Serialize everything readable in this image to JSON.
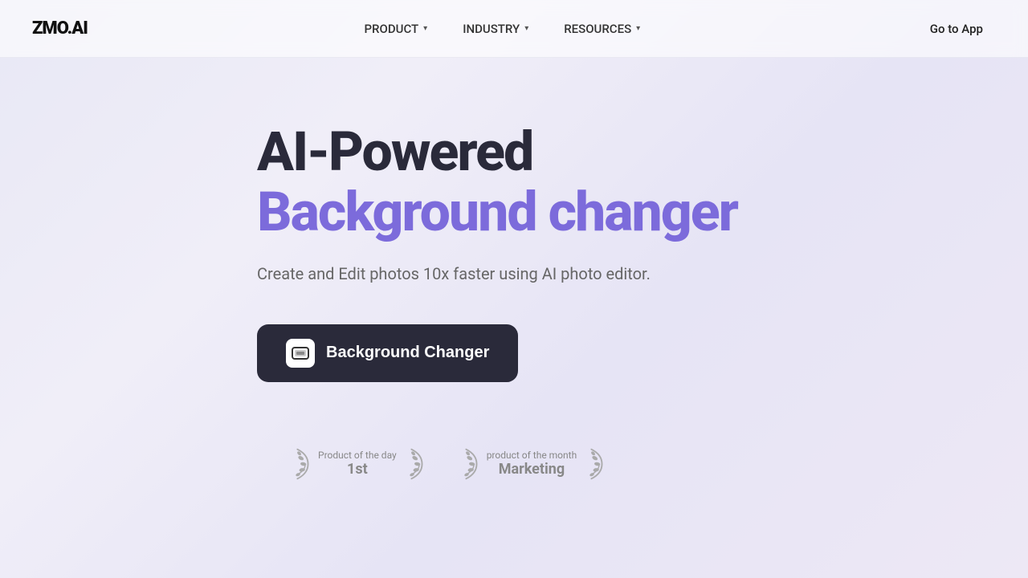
{
  "nav": {
    "logo": "ZMO.AI",
    "items": [
      {
        "label": "PRODUCT",
        "key": "product"
      },
      {
        "label": "INDUSTRY",
        "key": "industry"
      },
      {
        "label": "RESOURCES",
        "key": "resources"
      }
    ],
    "cta": "Go to App"
  },
  "hero": {
    "title_line1": "AI-Powered",
    "title_line2": "Background changer",
    "subtitle": "Create and Edit photos 10x faster using AI photo editor.",
    "cta_button": "Background Changer"
  },
  "badges": [
    {
      "label": "Product of the day",
      "value": "1st"
    },
    {
      "label": "product of the month",
      "value": "Marketing"
    }
  ]
}
